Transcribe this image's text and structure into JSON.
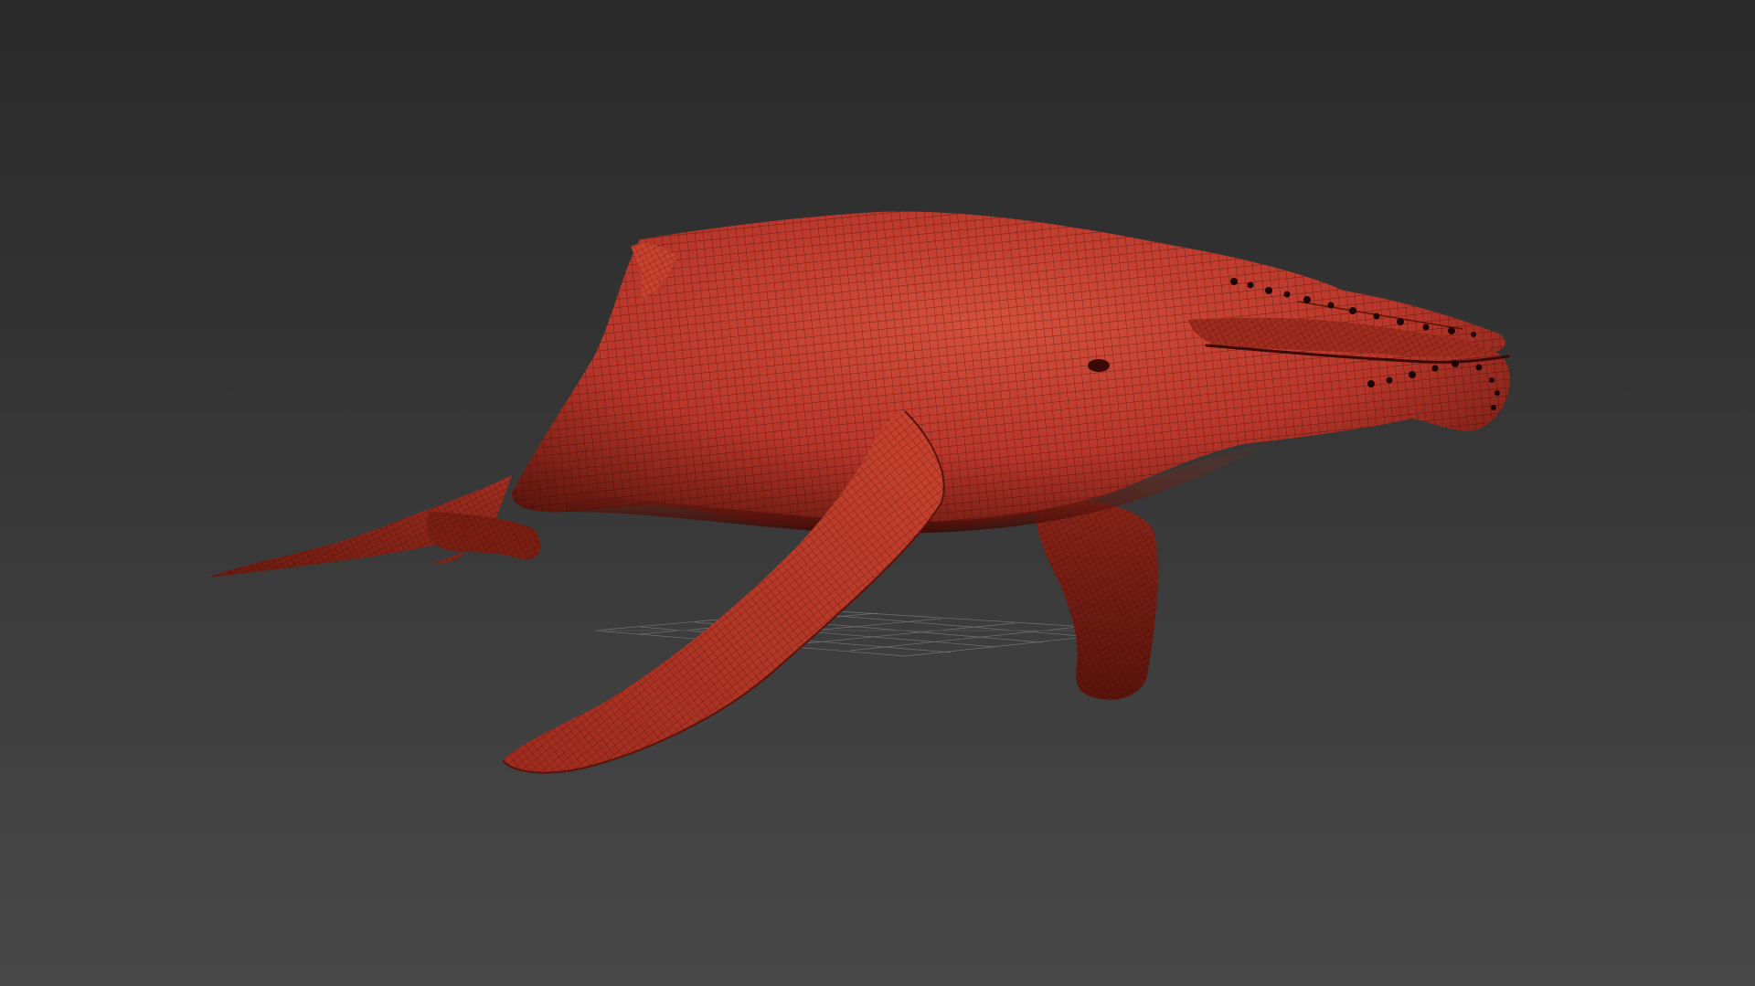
{
  "viewport": {
    "background_top": "#2a2a2a",
    "background_bottom": "#484848"
  },
  "model": {
    "subject": "humpback whale",
    "display_mode": "wireframe-on-shaded",
    "base_color": "#b8362a",
    "highlight_color": "#d4503c",
    "shadow_color": "#3a0a06",
    "wire_color": "#2a0805",
    "tubercle_color": "#1e0504"
  },
  "grid": {
    "color": "#9a9a9a",
    "visible": true
  }
}
